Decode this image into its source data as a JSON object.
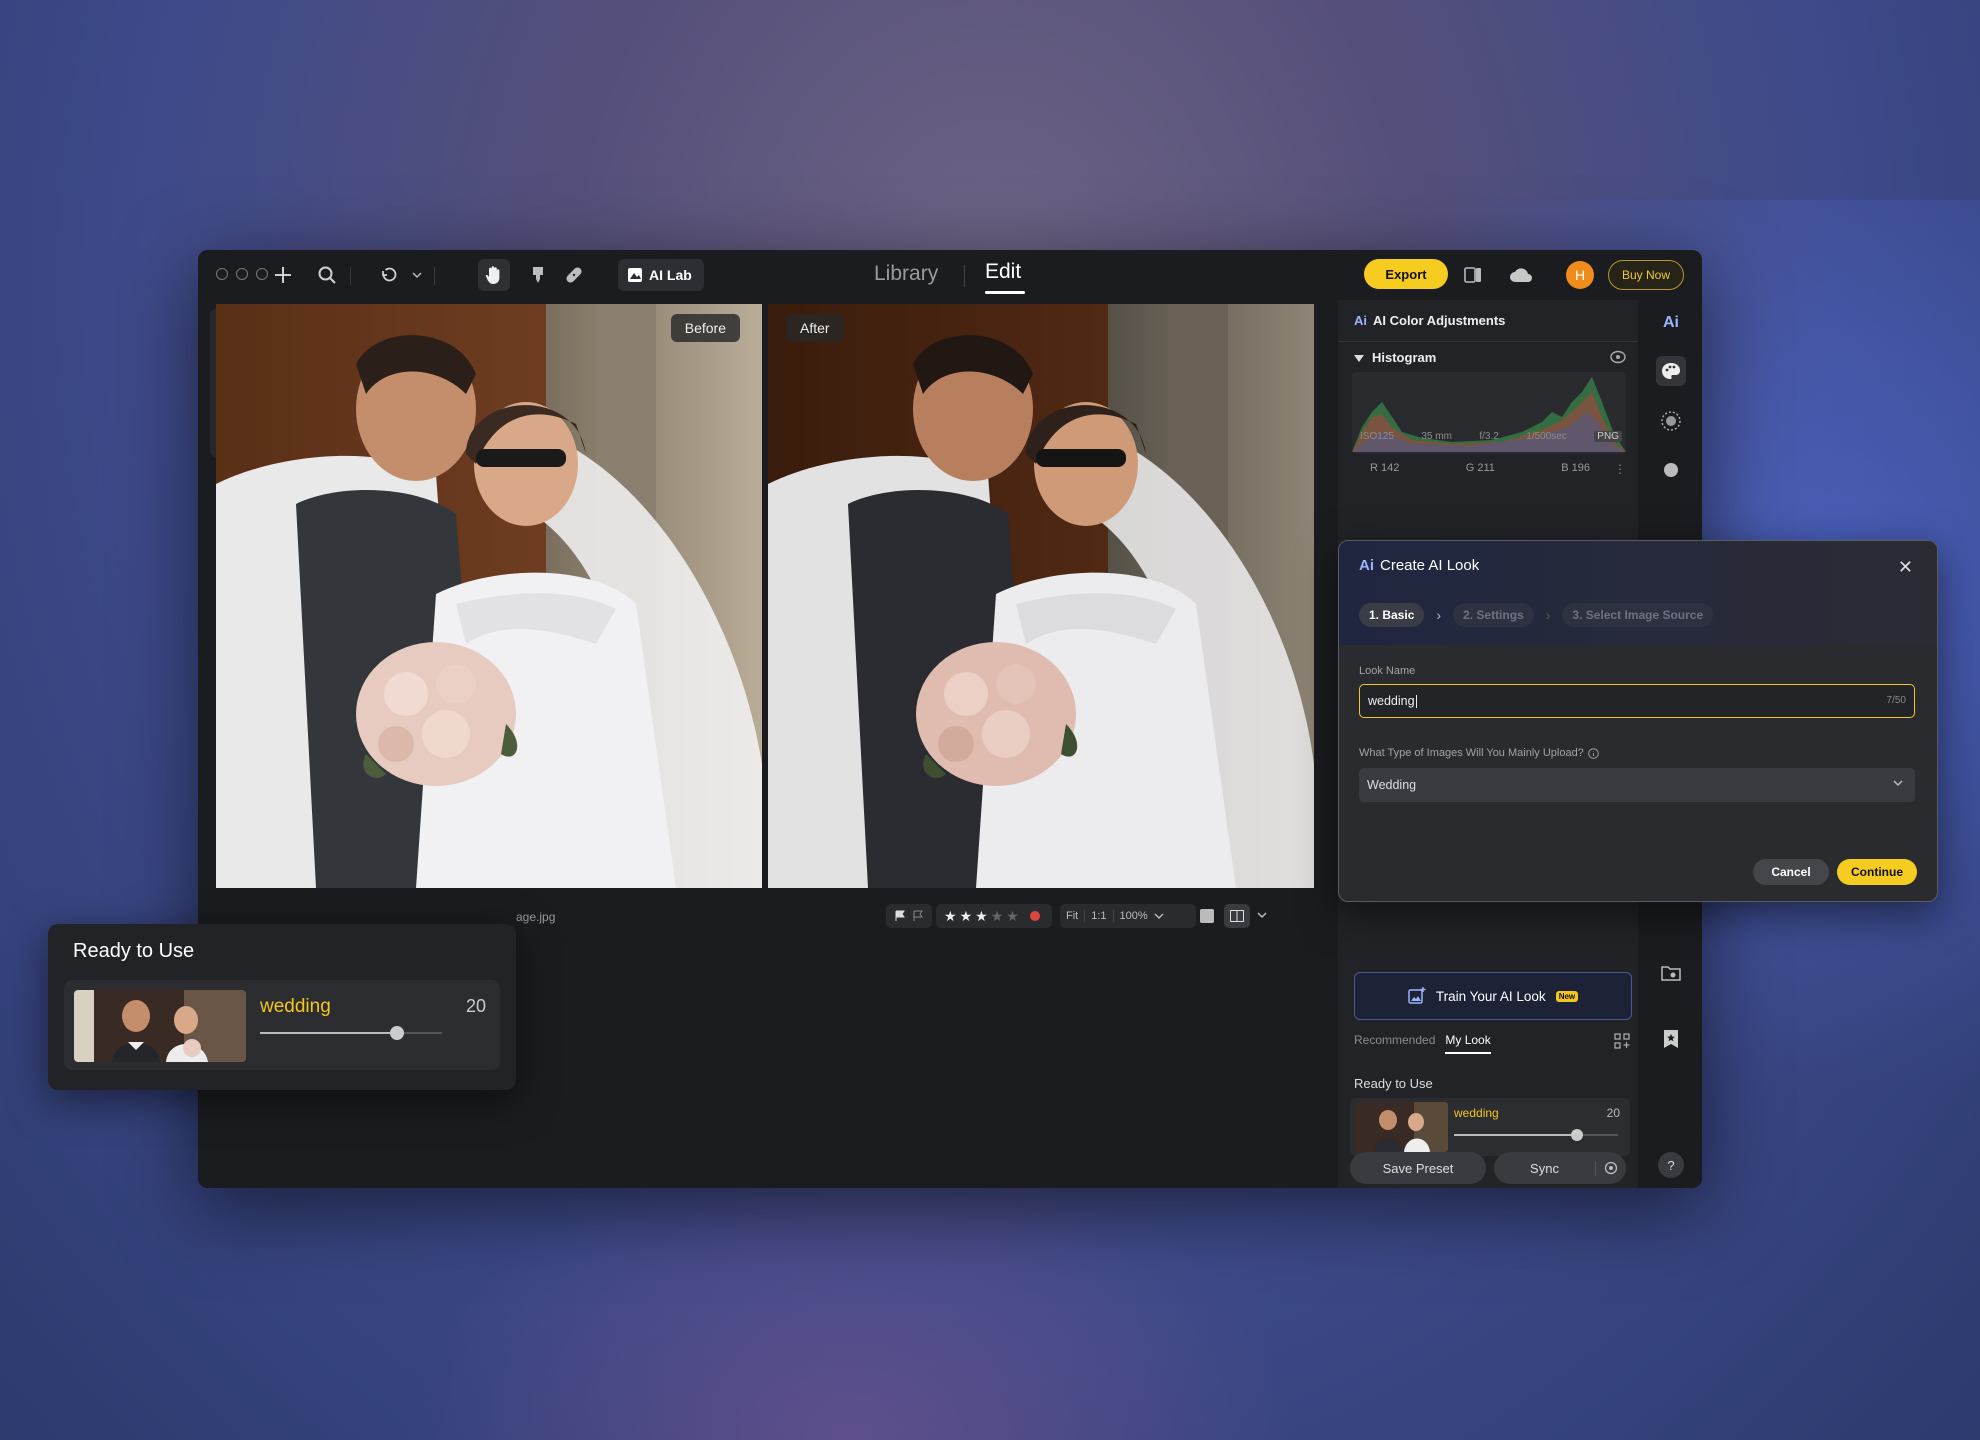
{
  "toolbar": {
    "ai_lab": "AI Lab",
    "nav_library": "Library",
    "nav_edit": "Edit",
    "export": "Export",
    "avatar_initial": "H",
    "buy_now": "Buy Now"
  },
  "canvas": {
    "before_label": "Before",
    "after_label": "After",
    "filename": "age.jpg",
    "rating": 3,
    "fit": "Fit",
    "one_to_one": "1:1",
    "zoom": "100%"
  },
  "panel": {
    "header": "AI Color Adjustments",
    "histogram_title": "Histogram",
    "meta": [
      "ISO125",
      "35 mm",
      "f/3.2",
      "1/500sec",
      "PNG"
    ],
    "r": "R 142",
    "g": "G 211",
    "b": "B 196",
    "train_btn": "Train Your AI Look",
    "new_badge": "New",
    "tab_recommended": "Recommended",
    "tab_mylook": "My Look",
    "ready_title": "Ready to Use",
    "preset_name": "wedding",
    "preset_value": "20",
    "preset_level": 0.75,
    "save_preset": "Save Preset",
    "sync": "Sync",
    "help": "?"
  },
  "dialog": {
    "title": "Create AI Look",
    "step1": "1. Basic",
    "step2": "2. Settings",
    "step3": "3. Select Image Source",
    "look_name_label": "Look Name",
    "look_name_value": "wedding",
    "counter": "7/50",
    "type_label": "What Type of Images Will You Mainly Upload?",
    "type_value": "Wedding",
    "cancel": "Cancel",
    "continue": "Continue"
  },
  "float_card": {
    "title": "Ready to Use",
    "preset_name": "wedding",
    "preset_value": "20",
    "preset_level": 0.75
  },
  "colors": {
    "accent_yellow": "#f7cc20",
    "avatar_orange": "#f08c1c"
  }
}
